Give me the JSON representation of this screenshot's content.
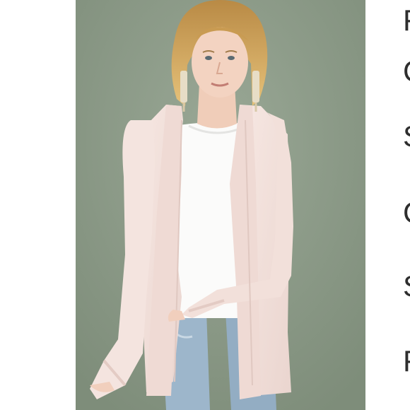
{
  "product_photo": {
    "alt": "",
    "background_color": "#8d9c89",
    "garment_color": "#f3e1dc",
    "top_color": "#fbfbfa",
    "denim_color": "#9bb3c8",
    "hair_color": "#d7a95d"
  },
  "side_panel": {
    "letters": [
      "F",
      "C",
      "S",
      "C",
      "S",
      "F"
    ]
  }
}
